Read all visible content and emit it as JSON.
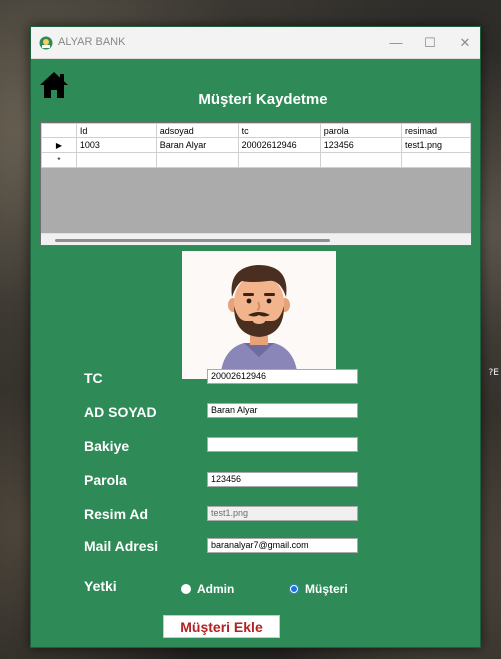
{
  "desktop": {
    "hint_text": "?E"
  },
  "window": {
    "title": "ALYAR BANK",
    "minimize": "—",
    "maximize": "☐",
    "close": "✕"
  },
  "page": {
    "title": "Müşteri Kaydetme"
  },
  "grid": {
    "columns": [
      "Id",
      "adsoyad",
      "tc",
      "parola",
      "resimad"
    ],
    "rows": [
      {
        "marker": "▶",
        "cells": [
          "1003",
          "Baran Alyar",
          "20002612946",
          "123456",
          "test1.png"
        ]
      },
      {
        "marker": "*",
        "cells": [
          "",
          "",
          "",
          "",
          ""
        ]
      }
    ]
  },
  "form": {
    "tc_label": "TC",
    "tc_value": "20002612946",
    "adsoyad_label": "AD SOYAD",
    "adsoyad_value": "Baran Alyar",
    "bakiye_label": "Bakiye",
    "bakiye_value": "",
    "parola_label": "Parola",
    "parola_value": "123456",
    "resimad_label": "Resim Ad",
    "resimad_value": "test1.png",
    "mail_label": "Mail Adresi",
    "mail_value": "baranalyar7@gmail.com",
    "yetki_label": "Yetki",
    "radio_admin": "Admin",
    "radio_musteri": "Müşteri",
    "submit_label": "Müşteri Ekle"
  },
  "colors": {
    "window_bg": "#2e8b57",
    "button_text": "#b22222",
    "radio_accent": "#1976d2"
  },
  "icons": {
    "home": "home-icon",
    "app": "bank-app-icon",
    "row_pointer": "row-pointer-icon"
  }
}
